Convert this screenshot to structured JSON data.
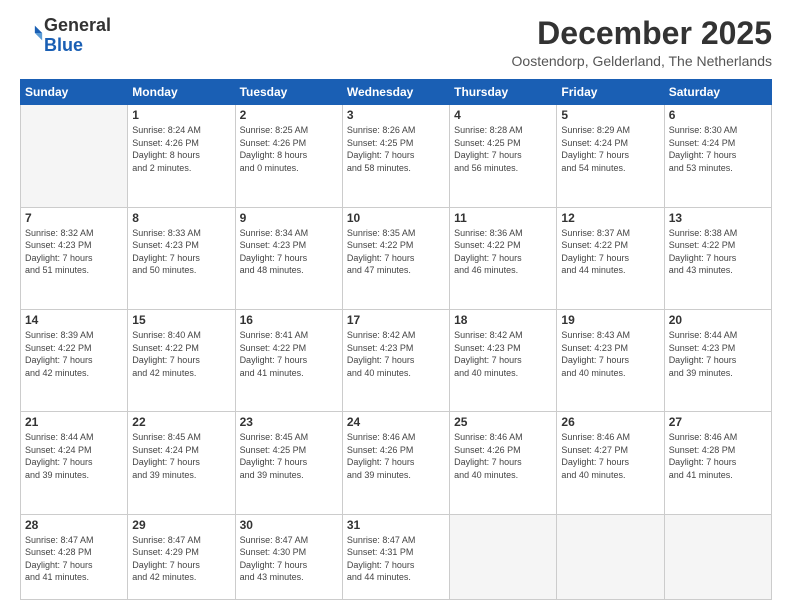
{
  "logo": {
    "general": "General",
    "blue": "Blue"
  },
  "header": {
    "month": "December 2025",
    "location": "Oostendorp, Gelderland, The Netherlands"
  },
  "weekdays": [
    "Sunday",
    "Monday",
    "Tuesday",
    "Wednesday",
    "Thursday",
    "Friday",
    "Saturday"
  ],
  "weeks": [
    [
      {
        "day": "",
        "info": ""
      },
      {
        "day": "1",
        "info": "Sunrise: 8:24 AM\nSunset: 4:26 PM\nDaylight: 8 hours\nand 2 minutes."
      },
      {
        "day": "2",
        "info": "Sunrise: 8:25 AM\nSunset: 4:26 PM\nDaylight: 8 hours\nand 0 minutes."
      },
      {
        "day": "3",
        "info": "Sunrise: 8:26 AM\nSunset: 4:25 PM\nDaylight: 7 hours\nand 58 minutes."
      },
      {
        "day": "4",
        "info": "Sunrise: 8:28 AM\nSunset: 4:25 PM\nDaylight: 7 hours\nand 56 minutes."
      },
      {
        "day": "5",
        "info": "Sunrise: 8:29 AM\nSunset: 4:24 PM\nDaylight: 7 hours\nand 54 minutes."
      },
      {
        "day": "6",
        "info": "Sunrise: 8:30 AM\nSunset: 4:24 PM\nDaylight: 7 hours\nand 53 minutes."
      }
    ],
    [
      {
        "day": "7",
        "info": "Sunrise: 8:32 AM\nSunset: 4:23 PM\nDaylight: 7 hours\nand 51 minutes."
      },
      {
        "day": "8",
        "info": "Sunrise: 8:33 AM\nSunset: 4:23 PM\nDaylight: 7 hours\nand 50 minutes."
      },
      {
        "day": "9",
        "info": "Sunrise: 8:34 AM\nSunset: 4:23 PM\nDaylight: 7 hours\nand 48 minutes."
      },
      {
        "day": "10",
        "info": "Sunrise: 8:35 AM\nSunset: 4:22 PM\nDaylight: 7 hours\nand 47 minutes."
      },
      {
        "day": "11",
        "info": "Sunrise: 8:36 AM\nSunset: 4:22 PM\nDaylight: 7 hours\nand 46 minutes."
      },
      {
        "day": "12",
        "info": "Sunrise: 8:37 AM\nSunset: 4:22 PM\nDaylight: 7 hours\nand 44 minutes."
      },
      {
        "day": "13",
        "info": "Sunrise: 8:38 AM\nSunset: 4:22 PM\nDaylight: 7 hours\nand 43 minutes."
      }
    ],
    [
      {
        "day": "14",
        "info": "Sunrise: 8:39 AM\nSunset: 4:22 PM\nDaylight: 7 hours\nand 42 minutes."
      },
      {
        "day": "15",
        "info": "Sunrise: 8:40 AM\nSunset: 4:22 PM\nDaylight: 7 hours\nand 42 minutes."
      },
      {
        "day": "16",
        "info": "Sunrise: 8:41 AM\nSunset: 4:22 PM\nDaylight: 7 hours\nand 41 minutes."
      },
      {
        "day": "17",
        "info": "Sunrise: 8:42 AM\nSunset: 4:23 PM\nDaylight: 7 hours\nand 40 minutes."
      },
      {
        "day": "18",
        "info": "Sunrise: 8:42 AM\nSunset: 4:23 PM\nDaylight: 7 hours\nand 40 minutes."
      },
      {
        "day": "19",
        "info": "Sunrise: 8:43 AM\nSunset: 4:23 PM\nDaylight: 7 hours\nand 40 minutes."
      },
      {
        "day": "20",
        "info": "Sunrise: 8:44 AM\nSunset: 4:23 PM\nDaylight: 7 hours\nand 39 minutes."
      }
    ],
    [
      {
        "day": "21",
        "info": "Sunrise: 8:44 AM\nSunset: 4:24 PM\nDaylight: 7 hours\nand 39 minutes."
      },
      {
        "day": "22",
        "info": "Sunrise: 8:45 AM\nSunset: 4:24 PM\nDaylight: 7 hours\nand 39 minutes."
      },
      {
        "day": "23",
        "info": "Sunrise: 8:45 AM\nSunset: 4:25 PM\nDaylight: 7 hours\nand 39 minutes."
      },
      {
        "day": "24",
        "info": "Sunrise: 8:46 AM\nSunset: 4:26 PM\nDaylight: 7 hours\nand 39 minutes."
      },
      {
        "day": "25",
        "info": "Sunrise: 8:46 AM\nSunset: 4:26 PM\nDaylight: 7 hours\nand 40 minutes."
      },
      {
        "day": "26",
        "info": "Sunrise: 8:46 AM\nSunset: 4:27 PM\nDaylight: 7 hours\nand 40 minutes."
      },
      {
        "day": "27",
        "info": "Sunrise: 8:46 AM\nSunset: 4:28 PM\nDaylight: 7 hours\nand 41 minutes."
      }
    ],
    [
      {
        "day": "28",
        "info": "Sunrise: 8:47 AM\nSunset: 4:28 PM\nDaylight: 7 hours\nand 41 minutes."
      },
      {
        "day": "29",
        "info": "Sunrise: 8:47 AM\nSunset: 4:29 PM\nDaylight: 7 hours\nand 42 minutes."
      },
      {
        "day": "30",
        "info": "Sunrise: 8:47 AM\nSunset: 4:30 PM\nDaylight: 7 hours\nand 43 minutes."
      },
      {
        "day": "31",
        "info": "Sunrise: 8:47 AM\nSunset: 4:31 PM\nDaylight: 7 hours\nand 44 minutes."
      },
      {
        "day": "",
        "info": ""
      },
      {
        "day": "",
        "info": ""
      },
      {
        "day": "",
        "info": ""
      }
    ]
  ]
}
